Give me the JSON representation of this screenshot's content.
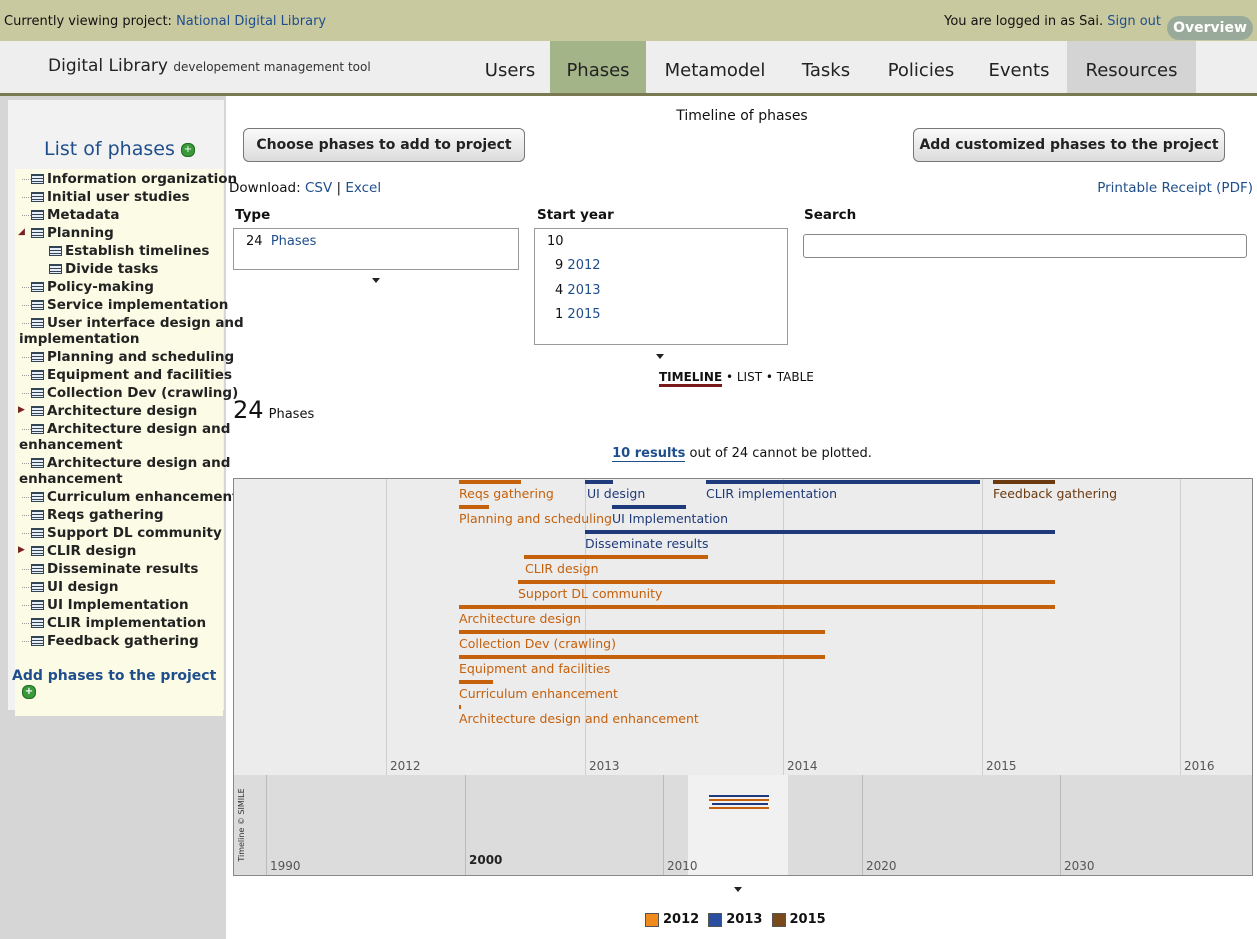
{
  "topbar": {
    "viewing_prefix": "Currently viewing project: ",
    "project_name": "National Digital Library",
    "logged_in": "You are logged in as Sai.",
    "sign_out": "Sign out",
    "overview": "Overview"
  },
  "header": {
    "logo_main": "Digital Library",
    "logo_sub": "developement management tool",
    "nav": [
      "Users",
      "Phases",
      "Metamodel",
      "Tasks",
      "Policies",
      "Events",
      "Resources"
    ],
    "active_tab": "Phases"
  },
  "sidebar": {
    "title": "List of phases",
    "items": [
      {
        "label": "Information organization"
      },
      {
        "label": "Initial user studies"
      },
      {
        "label": "Metadata"
      },
      {
        "label": "Planning"
      },
      {
        "label": "Establish timelines"
      },
      {
        "label": "Divide tasks"
      },
      {
        "label": "Policy-making"
      },
      {
        "label": "Service implementation"
      },
      {
        "label": "User interface design and"
      },
      {
        "label": "implementation"
      },
      {
        "label": "Planning and scheduling"
      },
      {
        "label": "Equipment and facilities"
      },
      {
        "label": "Collection Dev (crawling)"
      },
      {
        "label": "Architecture design"
      },
      {
        "label": "Architecture design and"
      },
      {
        "label": "enhancement"
      },
      {
        "label": "Architecture design and"
      },
      {
        "label": "enhancement"
      },
      {
        "label": "Curriculum enhancement"
      },
      {
        "label": "Reqs gathering"
      },
      {
        "label": "Support DL community"
      },
      {
        "label": "CLIR design"
      },
      {
        "label": "Disseminate results"
      },
      {
        "label": "UI design"
      },
      {
        "label": "UI Implementation"
      },
      {
        "label": "CLIR implementation"
      },
      {
        "label": "Feedback gathering"
      }
    ],
    "add_phases": "Add phases to the project"
  },
  "main": {
    "timeline_title": "Timeline of phases",
    "choose_btn": "Choose phases to add to project",
    "custom_btn": "Add customized phases to the project",
    "download_label": "Download:",
    "csv": "CSV",
    "sep": "|",
    "excel": "Excel",
    "receipt": "Printable Receipt (PDF)",
    "type_label": "Type",
    "type_count": "24",
    "type_value": "Phases",
    "start_label": "Start year",
    "start_rows": [
      {
        "count": "10",
        "year": ""
      },
      {
        "count": "9",
        "year": "2012"
      },
      {
        "count": "4",
        "year": "2013"
      },
      {
        "count": "1",
        "year": "2015"
      }
    ],
    "search_label": "Search",
    "search_placeholder": "",
    "view_timeline": "TIMELINE",
    "view_dot1": " • ",
    "view_list": "LIST",
    "view_dot2": " • ",
    "view_table": "TABLE",
    "count_big": "24",
    "count_word": "Phases",
    "results_link": "10 results",
    "results_rest": " out of 24 cannot be plotted."
  },
  "timeline": {
    "years": [
      "2012",
      "2013",
      "2014",
      "2015",
      "2016"
    ],
    "overview_years": [
      "1990",
      "2000",
      "2010",
      "2020",
      "2030"
    ],
    "copyright": "Timeline © SIMILE",
    "events": [
      {
        "label": "Reqs gathering",
        "color": "#c5600b"
      },
      {
        "label": "UI design",
        "color": "#1f3a7a"
      },
      {
        "label": "CLIR implementation",
        "color": "#1f3a7a"
      },
      {
        "label": "Feedback gathering",
        "color": "#6b3a10"
      },
      {
        "label": "Planning and scheduling",
        "color": "#c5600b"
      },
      {
        "label": "UI Implementation",
        "color": "#1f3a7a"
      },
      {
        "label": "Disseminate results",
        "color": "#1f3a7a"
      },
      {
        "label": "CLIR design",
        "color": "#c5600b"
      },
      {
        "label": "Support DL community",
        "color": "#c5600b"
      },
      {
        "label": "Architecture design",
        "color": "#c5600b"
      },
      {
        "label": "Collection Dev (crawling)",
        "color": "#c5600b"
      },
      {
        "label": "Equipment and facilities",
        "color": "#c5600b"
      },
      {
        "label": "Curriculum enhancement",
        "color": "#c5600b"
      },
      {
        "label": "Architecture design and enhancement",
        "color": "#c5600b"
      }
    ]
  },
  "legend": [
    {
      "label": "2012",
      "color": "#f08a1c"
    },
    {
      "label": "2013",
      "color": "#2a4fa0"
    },
    {
      "label": "2015",
      "color": "#7a4a1c"
    }
  ]
}
